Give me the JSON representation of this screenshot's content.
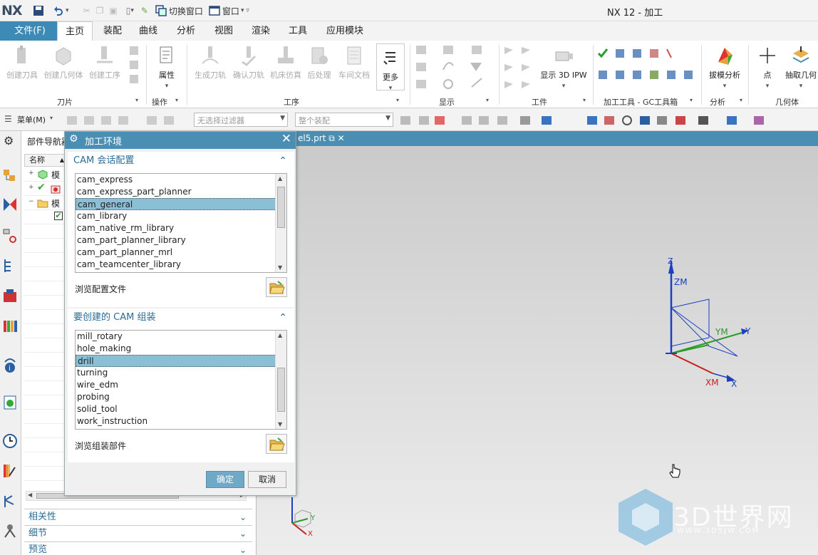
{
  "app": {
    "logo": "NX",
    "title": "NX 12 - 加工",
    "switch_window": "切换窗口",
    "window_menu": "窗口"
  },
  "tabs": [
    "文件(F)",
    "主页",
    "装配",
    "曲线",
    "分析",
    "视图",
    "渲染",
    "工具",
    "应用模块"
  ],
  "ribbon": {
    "buttons": [
      "创建刀具",
      "创建几何体",
      "创建工序",
      "属性",
      "生成刀轨",
      "确认刀轨",
      "机床仿真",
      "后处理",
      "车间文档",
      "更多",
      "显示 3D IPW",
      "拔模分析",
      "点",
      "抽取几何"
    ],
    "groups": [
      "刀片",
      "操作",
      "工序",
      "显示",
      "工件",
      "加工工具 - GC工具箱",
      "分析",
      "几何体"
    ]
  },
  "toolbar": {
    "menu": "菜单(M)",
    "filter_placeholder": "无选择过滤器",
    "assembly_scope": "整个装配"
  },
  "navigator": {
    "title": "部件导航器",
    "column_name": "名称",
    "rows": [
      "模",
      "",
      "模"
    ],
    "accordions": [
      "相关性",
      "细节",
      "预览"
    ]
  },
  "document_tab": "el5.prt",
  "dialog": {
    "title": "加工环境",
    "section1": {
      "header": "CAM 会话配置",
      "items": [
        "cam_express",
        "cam_express_part_planner",
        "cam_general",
        "cam_library",
        "cam_native_rm_library",
        "cam_part_planner_library",
        "cam_part_planner_mrl",
        "cam_teamcenter_library"
      ],
      "selected": "cam_general",
      "browse_label": "浏览配置文件"
    },
    "section2": {
      "header": "要创建的 CAM 组装",
      "items": [
        "mill_rotary",
        "hole_making",
        "drill",
        "turning",
        "wire_edm",
        "probing",
        "solid_tool",
        "work_instruction"
      ],
      "selected": "drill",
      "browse_label": "浏览组装部件"
    },
    "ok": "确定",
    "cancel": "取消"
  },
  "axes": {
    "z": "Z",
    "zm": "ZM",
    "y": "Y",
    "ym": "YM",
    "x": "X",
    "xm": "XM",
    "mini_y": "Y",
    "mini_x": "X"
  },
  "watermark": {
    "text": "3D世界网",
    "url": "WWW.3DSJW.COM"
  },
  "colors": {
    "accent": "#4a8fb3",
    "file_tab": "#3e8ab6",
    "selection": "#8bbfd6",
    "axis_z": "#1a3fc0",
    "axis_y": "#2a9a2a",
    "axis_x": "#c82020"
  }
}
